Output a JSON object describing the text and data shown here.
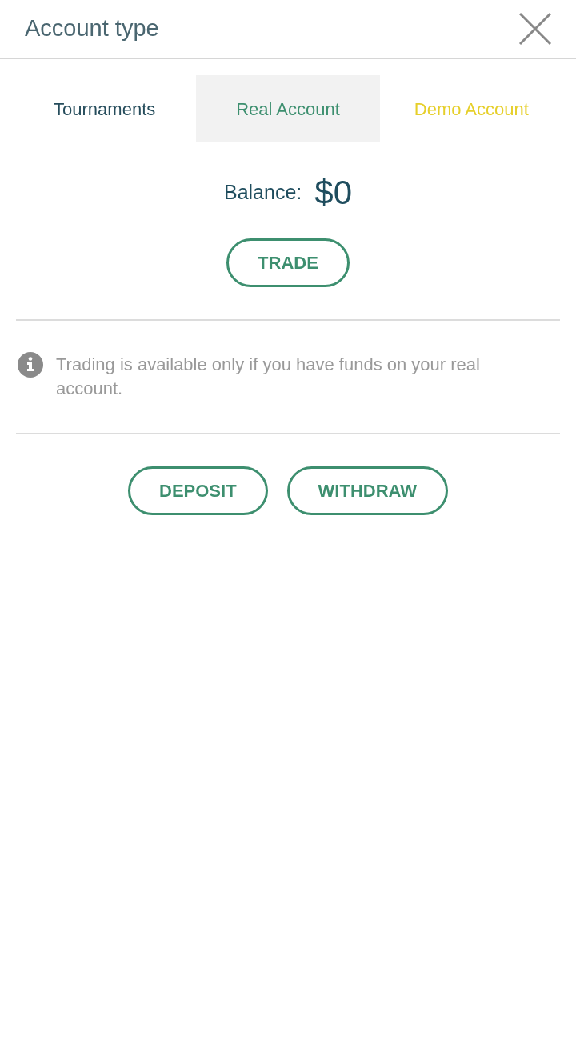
{
  "header": {
    "title": "Account type"
  },
  "tabs": [
    {
      "label": "Tournaments",
      "selected": false,
      "color": "#264d5c"
    },
    {
      "label": "Real Account",
      "selected": true,
      "color": "#3d8f6f"
    },
    {
      "label": "Demo Account",
      "selected": false,
      "color": "#e6cf2a"
    }
  ],
  "balance": {
    "label": "Balance:",
    "value": "$0"
  },
  "trade_button": "TRADE",
  "info": "Trading is available only if you have funds on your real account.",
  "buttons": [
    "DEPOSIT",
    "WITHDRAW"
  ]
}
